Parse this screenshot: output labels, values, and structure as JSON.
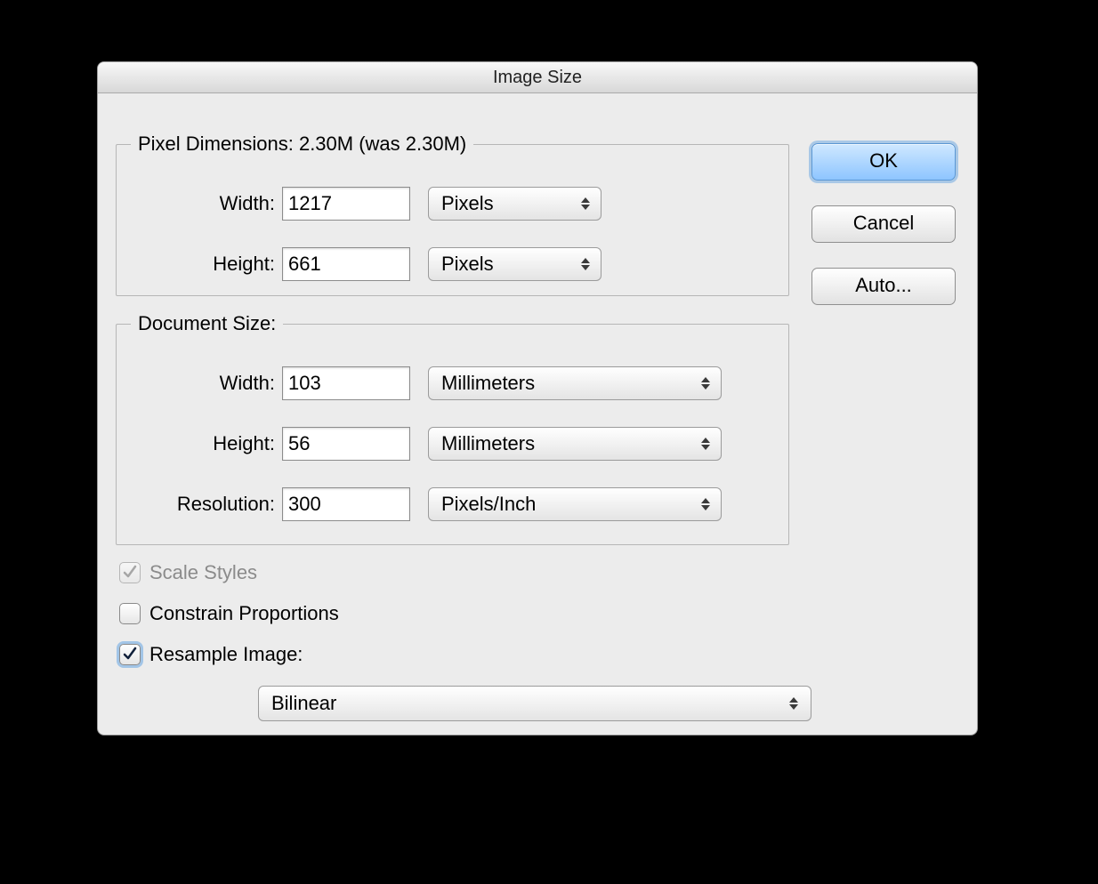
{
  "window": {
    "title": "Image Size"
  },
  "pixel": {
    "legend": "Pixel Dimensions:  2.30M (was 2.30M)",
    "width_label": "Width:",
    "width_value": "1217",
    "height_label": "Height:",
    "height_value": "661",
    "unit_width": "Pixels",
    "unit_height": "Pixels"
  },
  "doc": {
    "legend": "Document Size:",
    "width_label": "Width:",
    "width_value": "103",
    "width_unit": "Millimeters",
    "height_label": "Height:",
    "height_value": "56",
    "height_unit": "Millimeters",
    "resolution_label": "Resolution:",
    "resolution_value": "300",
    "resolution_unit": "Pixels/Inch"
  },
  "buttons": {
    "ok": "OK",
    "cancel": "Cancel",
    "auto": "Auto..."
  },
  "checks": {
    "scale_styles": "Scale Styles",
    "constrain": "Constrain Proportions",
    "resample": "Resample Image:"
  },
  "resample": {
    "method": "Bilinear"
  }
}
